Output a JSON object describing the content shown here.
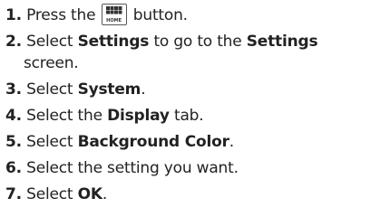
{
  "steps": [
    {
      "num": "1.",
      "before": "Press the",
      "icon": "home-grid-icon",
      "icon_label": "HOME",
      "after": "button."
    },
    {
      "num": "2.",
      "t1": "Select",
      "b1": "Settings",
      "t2": "to go to the",
      "b2": "Settings",
      "t3": "screen."
    },
    {
      "num": "3.",
      "t1": "Select",
      "b1": "System",
      "t2": "."
    },
    {
      "num": "4.",
      "t1": "Select the",
      "b1": "Display",
      "t2": "tab."
    },
    {
      "num": "5.",
      "t1": "Select",
      "b1": "Background Color",
      "t2": "."
    },
    {
      "num": "6.",
      "t1": "Select the setting you want."
    },
    {
      "num": "7.",
      "t1": "Select",
      "b1": "OK",
      "t2": "."
    }
  ]
}
